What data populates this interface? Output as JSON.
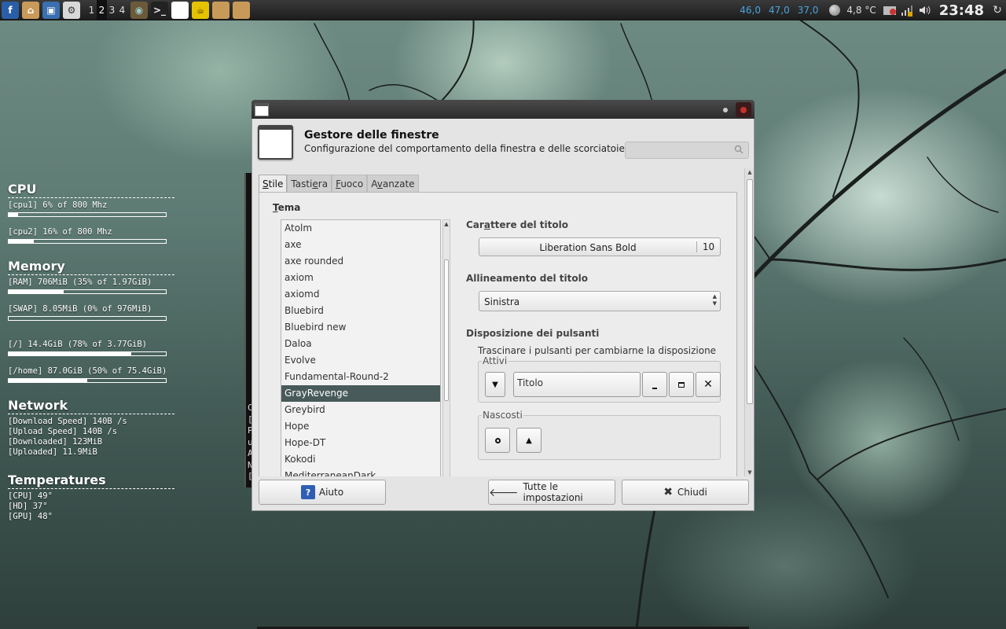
{
  "panel": {
    "launchers": [
      {
        "name": "fedora-menu-icon",
        "glyph": "f",
        "bg": "#2a5fa8",
        "fg": "#fff"
      },
      {
        "name": "home-folder-icon",
        "glyph": "⌂",
        "bg": "#c89a5a",
        "fg": "#fff"
      },
      {
        "name": "system-monitor-icon",
        "glyph": "▣",
        "bg": "#3a6fb0",
        "fg": "#fff"
      },
      {
        "name": "settings-icon",
        "glyph": "⚙",
        "bg": "#d8d8d8",
        "fg": "#333"
      }
    ],
    "workspaces": [
      "1",
      "2",
      "3",
      "4"
    ],
    "active_workspace": 1,
    "taskbar": [
      {
        "name": "web-browser-icon",
        "glyph": "◉",
        "bg": "#6b5a3a",
        "fg": "#9cc"
      },
      {
        "name": "terminal-icon",
        "glyph": ">_",
        "bg": "#222",
        "fg": "#eee"
      },
      {
        "name": "window-icon",
        "glyph": "",
        "bg": "#fff",
        "fg": "#333"
      },
      {
        "name": "teapot-icon",
        "glyph": "☕",
        "bg": "#e5c300",
        "fg": "#5a3a00"
      },
      {
        "name": "folder-icon",
        "glyph": "",
        "bg": "#c89a5a",
        "fg": "#fff"
      },
      {
        "name": "folder-icon-2",
        "glyph": "",
        "bg": "#c89a5a",
        "fg": "#fff"
      }
    ],
    "load": [
      "46,0",
      "47,0",
      "37,0"
    ],
    "weather": "4,8 °C",
    "clock": "23:48"
  },
  "conky": {
    "cpu": {
      "title": "CPU",
      "rows": [
        {
          "label": "[cpu1] 6% of 800 Mhz",
          "fill": 0.06
        },
        {
          "label": "[cpu2] 16% of 800 Mhz",
          "fill": 0.16
        }
      ]
    },
    "memory": {
      "title": "Memory",
      "rows": [
        {
          "label": "[RAM] 706MiB (35% of 1.97GiB)",
          "fill": 0.35
        },
        {
          "label": "[SWAP] 8.05MiB (0% of 976MiB)",
          "fill": 0.0
        },
        {
          "label": "[/] 14.4GiB (78% of 3.77GiB)",
          "fill": 0.78
        },
        {
          "label": "[/home] 87.0GiB (50% of 75.4GiB)",
          "fill": 0.5
        }
      ]
    },
    "network": {
      "title": "Network",
      "lines": [
        "[Download Speed] 140B  /s",
        "[Upload Speed] 140B  /s",
        "[Downloaded] 123MiB",
        "[Uploaded] 11.9MiB"
      ]
    },
    "temperatures": {
      "title": "Temperatures",
      "lines": [
        "[CPU] 49°",
        "[HD] 37°",
        "[GPU] 48°"
      ]
    }
  },
  "terminal": {
    "lines": [
      "C",
      "[",
      "P",
      "u",
      "A",
      "N",
      "["
    ]
  },
  "dialog": {
    "title": "Gestore delle finestre",
    "subtitle": "Configurazione del comportamento della finestra e delle scorciatoie",
    "search_placeholder": "",
    "tabs": [
      {
        "pre": "",
        "mnemonic": "S",
        "post": "tile",
        "active": true
      },
      {
        "pre": "Tasti",
        "mnemonic": "e",
        "post": "ra",
        "active": false
      },
      {
        "pre": "",
        "mnemonic": "F",
        "post": "uoco",
        "active": false
      },
      {
        "pre": "A",
        "mnemonic": "v",
        "post": "anzate",
        "active": false
      }
    ],
    "theme_label_mnemonic": "T",
    "theme_label_rest": "ema",
    "themes": [
      "Atolm",
      "axe",
      "axe rounded",
      "axiom",
      "axiomd",
      "Bluebird",
      "Bluebird new",
      "Daloa",
      "Evolve",
      "Fundamental-Round-2",
      "GrayRevenge",
      "Greybird",
      "Hope",
      "Hope-DT",
      "Kokodi",
      "MediterraneanDark"
    ],
    "selected_theme": "GrayRevenge",
    "font_section_pre": "Car",
    "font_section_mnemonic": "a",
    "font_section_post": "ttere del titolo",
    "font_name": "Liberation Sans Bold",
    "font_size": "10",
    "align_section": "Allineamento del titolo",
    "align_value": "Sinistra",
    "layout_section": "Disposizione dei pulsanti",
    "layout_hint": "Trascinare i pulsanti per cambiarne la disposizione",
    "active_group": "Attivi",
    "title_slot": "Titolo",
    "hidden_group": "Nascosti",
    "help_label": "Aiuto",
    "all_settings_label": "Tutte le impostazioni",
    "close_label": "Chiudi"
  }
}
